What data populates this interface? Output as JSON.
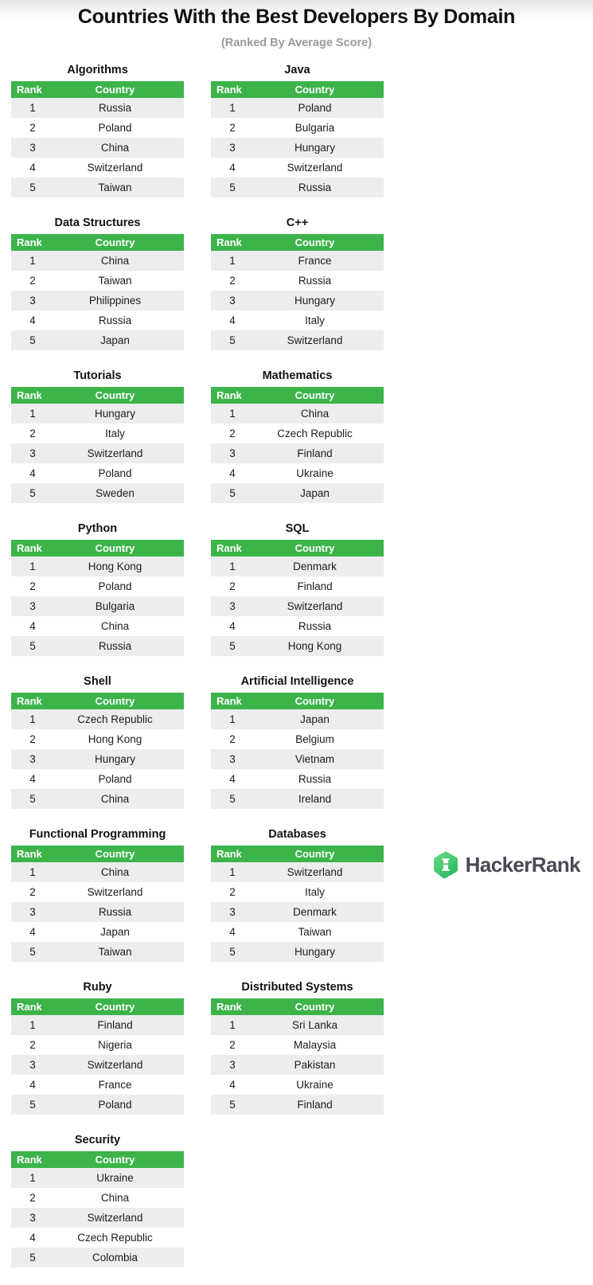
{
  "header": {
    "title": "Countries With the Best Developers By Domain",
    "subtitle": "(Ranked By Average Score)"
  },
  "table_columns": {
    "rank": "Rank",
    "country": "Country"
  },
  "colors": {
    "header_green": "#3cb44a",
    "row_stripe": "#ededed",
    "row_plain": "#ffffff",
    "title_text": "#121212",
    "subtitle_text": "#9b9b9b",
    "logo_text": "#4a4a55",
    "logo_green_light": "#5fd77e",
    "logo_green_dark": "#2fb866"
  },
  "panels": [
    {
      "title": "Algorithms",
      "rows": [
        {
          "rank": "1",
          "country": "Russia"
        },
        {
          "rank": "2",
          "country": "Poland"
        },
        {
          "rank": "3",
          "country": "China"
        },
        {
          "rank": "4",
          "country": "Switzerland"
        },
        {
          "rank": "5",
          "country": "Taiwan"
        }
      ]
    },
    {
      "title": "Java",
      "rows": [
        {
          "rank": "1",
          "country": "Poland"
        },
        {
          "rank": "2",
          "country": "Bulgaria"
        },
        {
          "rank": "3",
          "country": "Hungary"
        },
        {
          "rank": "4",
          "country": "Switzerland"
        },
        {
          "rank": "5",
          "country": "Russia"
        }
      ]
    },
    {
      "title": "Data Structures",
      "rows": [
        {
          "rank": "1",
          "country": "China"
        },
        {
          "rank": "2",
          "country": "Taiwan"
        },
        {
          "rank": "3",
          "country": "Philippines"
        },
        {
          "rank": "4",
          "country": "Russia"
        },
        {
          "rank": "5",
          "country": "Japan"
        }
      ]
    },
    {
      "title": "C++",
      "rows": [
        {
          "rank": "1",
          "country": "France"
        },
        {
          "rank": "2",
          "country": "Russia"
        },
        {
          "rank": "3",
          "country": "Hungary"
        },
        {
          "rank": "4",
          "country": "Italy"
        },
        {
          "rank": "5",
          "country": "Switzerland"
        }
      ]
    },
    {
      "title": "Tutorials",
      "rows": [
        {
          "rank": "1",
          "country": "Hungary"
        },
        {
          "rank": "2",
          "country": "Italy"
        },
        {
          "rank": "3",
          "country": "Switzerland"
        },
        {
          "rank": "4",
          "country": "Poland"
        },
        {
          "rank": "5",
          "country": "Sweden"
        }
      ]
    },
    {
      "title": "Mathematics",
      "rows": [
        {
          "rank": "1",
          "country": "China"
        },
        {
          "rank": "2",
          "country": "Czech Republic"
        },
        {
          "rank": "3",
          "country": "Finland"
        },
        {
          "rank": "4",
          "country": "Ukraine"
        },
        {
          "rank": "5",
          "country": "Japan"
        }
      ]
    },
    {
      "title": "Python",
      "rows": [
        {
          "rank": "1",
          "country": "Hong Kong"
        },
        {
          "rank": "2",
          "country": "Poland"
        },
        {
          "rank": "3",
          "country": "Bulgaria"
        },
        {
          "rank": "4",
          "country": "China"
        },
        {
          "rank": "5",
          "country": "Russia"
        }
      ]
    },
    {
      "title": "SQL",
      "rows": [
        {
          "rank": "1",
          "country": "Denmark"
        },
        {
          "rank": "2",
          "country": "Finland"
        },
        {
          "rank": "3",
          "country": "Switzerland"
        },
        {
          "rank": "4",
          "country": "Russia"
        },
        {
          "rank": "5",
          "country": "Hong Kong"
        }
      ]
    },
    {
      "title": "Shell",
      "rows": [
        {
          "rank": "1",
          "country": "Czech Republic"
        },
        {
          "rank": "2",
          "country": "Hong Kong"
        },
        {
          "rank": "3",
          "country": "Hungary"
        },
        {
          "rank": "4",
          "country": "Poland"
        },
        {
          "rank": "5",
          "country": "China"
        }
      ]
    },
    {
      "title": "Artificial Intelligence",
      "rows": [
        {
          "rank": "1",
          "country": "Japan"
        },
        {
          "rank": "2",
          "country": "Belgium"
        },
        {
          "rank": "3",
          "country": "Vietnam"
        },
        {
          "rank": "4",
          "country": "Russia"
        },
        {
          "rank": "5",
          "country": "Ireland"
        }
      ]
    },
    {
      "title": "Functional Programming",
      "rows": [
        {
          "rank": "1",
          "country": "China"
        },
        {
          "rank": "2",
          "country": "Switzerland"
        },
        {
          "rank": "3",
          "country": "Russia"
        },
        {
          "rank": "4",
          "country": "Japan"
        },
        {
          "rank": "5",
          "country": "Taiwan"
        }
      ]
    },
    {
      "title": "Databases",
      "rows": [
        {
          "rank": "1",
          "country": "Switzerland"
        },
        {
          "rank": "2",
          "country": "Italy"
        },
        {
          "rank": "3",
          "country": "Denmark"
        },
        {
          "rank": "4",
          "country": "Taiwan"
        },
        {
          "rank": "5",
          "country": "Hungary"
        }
      ]
    },
    {
      "title": "Ruby",
      "rows": [
        {
          "rank": "1",
          "country": "Finland"
        },
        {
          "rank": "2",
          "country": "Nigeria"
        },
        {
          "rank": "3",
          "country": "Switzerland"
        },
        {
          "rank": "4",
          "country": "France"
        },
        {
          "rank": "5",
          "country": "Poland"
        }
      ]
    },
    {
      "title": "Distributed Systems",
      "rows": [
        {
          "rank": "1",
          "country": "Sri Lanka"
        },
        {
          "rank": "2",
          "country": "Malaysia"
        },
        {
          "rank": "3",
          "country": "Pakistan"
        },
        {
          "rank": "4",
          "country": "Ukraine"
        },
        {
          "rank": "5",
          "country": "Finland"
        }
      ]
    },
    {
      "title": "Security",
      "rows": [
        {
          "rank": "1",
          "country": "Ukraine"
        },
        {
          "rank": "2",
          "country": "China"
        },
        {
          "rank": "3",
          "country": "Switzerland"
        },
        {
          "rank": "4",
          "country": "Czech Republic"
        },
        {
          "rank": "5",
          "country": "Colombia"
        }
      ]
    }
  ],
  "footer": {
    "brand_name": "HackerRank",
    "logo_letter": "H"
  }
}
